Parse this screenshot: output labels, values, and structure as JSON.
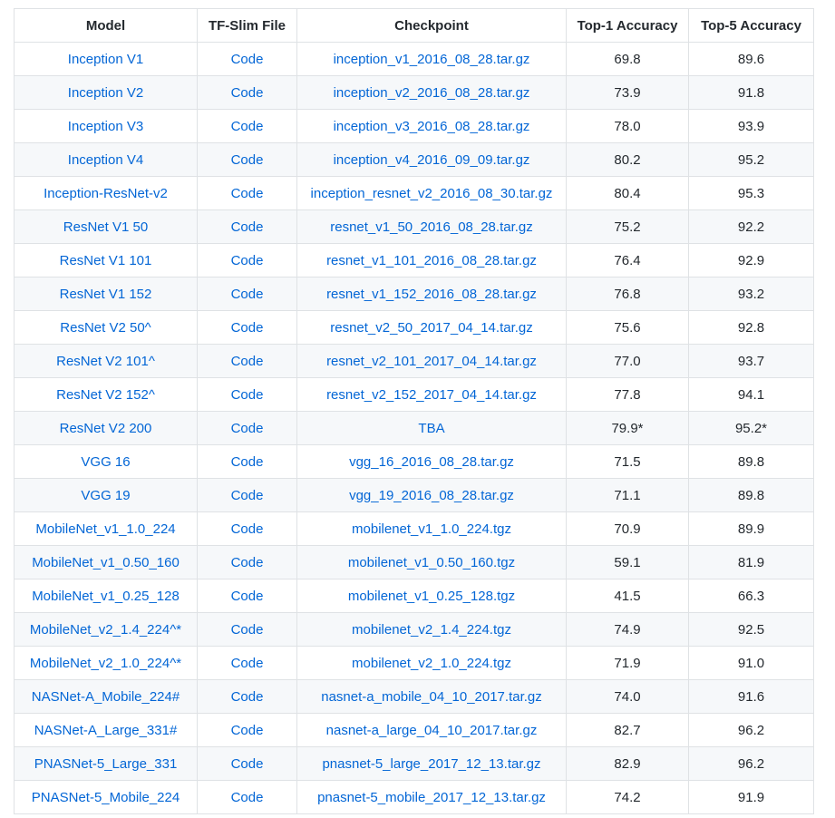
{
  "table": {
    "headers": [
      "Model",
      "TF-Slim File",
      "Checkpoint",
      "Top-1 Accuracy",
      "Top-5 Accuracy"
    ],
    "rows": [
      {
        "model": "Inception V1",
        "code": "Code",
        "checkpoint": "inception_v1_2016_08_28.tar.gz",
        "top1": "69.8",
        "top5": "89.6"
      },
      {
        "model": "Inception V2",
        "code": "Code",
        "checkpoint": "inception_v2_2016_08_28.tar.gz",
        "top1": "73.9",
        "top5": "91.8"
      },
      {
        "model": "Inception V3",
        "code": "Code",
        "checkpoint": "inception_v3_2016_08_28.tar.gz",
        "top1": "78.0",
        "top5": "93.9"
      },
      {
        "model": "Inception V4",
        "code": "Code",
        "checkpoint": "inception_v4_2016_09_09.tar.gz",
        "top1": "80.2",
        "top5": "95.2"
      },
      {
        "model": "Inception-ResNet-v2",
        "code": "Code",
        "checkpoint": "inception_resnet_v2_2016_08_30.tar.gz",
        "top1": "80.4",
        "top5": "95.3"
      },
      {
        "model": "ResNet V1 50",
        "code": "Code",
        "checkpoint": "resnet_v1_50_2016_08_28.tar.gz",
        "top1": "75.2",
        "top5": "92.2"
      },
      {
        "model": "ResNet V1 101",
        "code": "Code",
        "checkpoint": "resnet_v1_101_2016_08_28.tar.gz",
        "top1": "76.4",
        "top5": "92.9"
      },
      {
        "model": "ResNet V1 152",
        "code": "Code",
        "checkpoint": "resnet_v1_152_2016_08_28.tar.gz",
        "top1": "76.8",
        "top5": "93.2"
      },
      {
        "model": "ResNet V2 50^",
        "code": "Code",
        "checkpoint": "resnet_v2_50_2017_04_14.tar.gz",
        "top1": "75.6",
        "top5": "92.8"
      },
      {
        "model": "ResNet V2 101^",
        "code": "Code",
        "checkpoint": "resnet_v2_101_2017_04_14.tar.gz",
        "top1": "77.0",
        "top5": "93.7"
      },
      {
        "model": "ResNet V2 152^",
        "code": "Code",
        "checkpoint": "resnet_v2_152_2017_04_14.tar.gz",
        "top1": "77.8",
        "top5": "94.1"
      },
      {
        "model": "ResNet V2 200",
        "code": "Code",
        "checkpoint": "TBA",
        "top1": "79.9*",
        "top5": "95.2*"
      },
      {
        "model": "VGG 16",
        "code": "Code",
        "checkpoint": "vgg_16_2016_08_28.tar.gz",
        "top1": "71.5",
        "top5": "89.8"
      },
      {
        "model": "VGG 19",
        "code": "Code",
        "checkpoint": "vgg_19_2016_08_28.tar.gz",
        "top1": "71.1",
        "top5": "89.8"
      },
      {
        "model": "MobileNet_v1_1.0_224",
        "code": "Code",
        "checkpoint": "mobilenet_v1_1.0_224.tgz",
        "top1": "70.9",
        "top5": "89.9"
      },
      {
        "model": "MobileNet_v1_0.50_160",
        "code": "Code",
        "checkpoint": "mobilenet_v1_0.50_160.tgz",
        "top1": "59.1",
        "top5": "81.9"
      },
      {
        "model": "MobileNet_v1_0.25_128",
        "code": "Code",
        "checkpoint": "mobilenet_v1_0.25_128.tgz",
        "top1": "41.5",
        "top5": "66.3"
      },
      {
        "model": "MobileNet_v2_1.4_224^*",
        "code": "Code",
        "checkpoint": "mobilenet_v2_1.4_224.tgz",
        "top1": "74.9",
        "top5": "92.5"
      },
      {
        "model": "MobileNet_v2_1.0_224^*",
        "code": "Code",
        "checkpoint": "mobilenet_v2_1.0_224.tgz",
        "top1": "71.9",
        "top5": "91.0"
      },
      {
        "model": "NASNet-A_Mobile_224#",
        "code": "Code",
        "checkpoint": "nasnet-a_mobile_04_10_2017.tar.gz",
        "top1": "74.0",
        "top5": "91.6"
      },
      {
        "model": "NASNet-A_Large_331#",
        "code": "Code",
        "checkpoint": "nasnet-a_large_04_10_2017.tar.gz",
        "top1": "82.7",
        "top5": "96.2"
      },
      {
        "model": "PNASNet-5_Large_331",
        "code": "Code",
        "checkpoint": "pnasnet-5_large_2017_12_13.tar.gz",
        "top1": "82.9",
        "top5": "96.2"
      },
      {
        "model": "PNASNet-5_Mobile_224",
        "code": "Code",
        "checkpoint": "pnasnet-5_mobile_2017_12_13.tar.gz",
        "top1": "74.2",
        "top5": "91.9"
      }
    ]
  },
  "colors": {
    "link": "#0366d6",
    "text": "#24292e",
    "border": "#dfe2e5",
    "stripe": "#f6f8fa"
  }
}
